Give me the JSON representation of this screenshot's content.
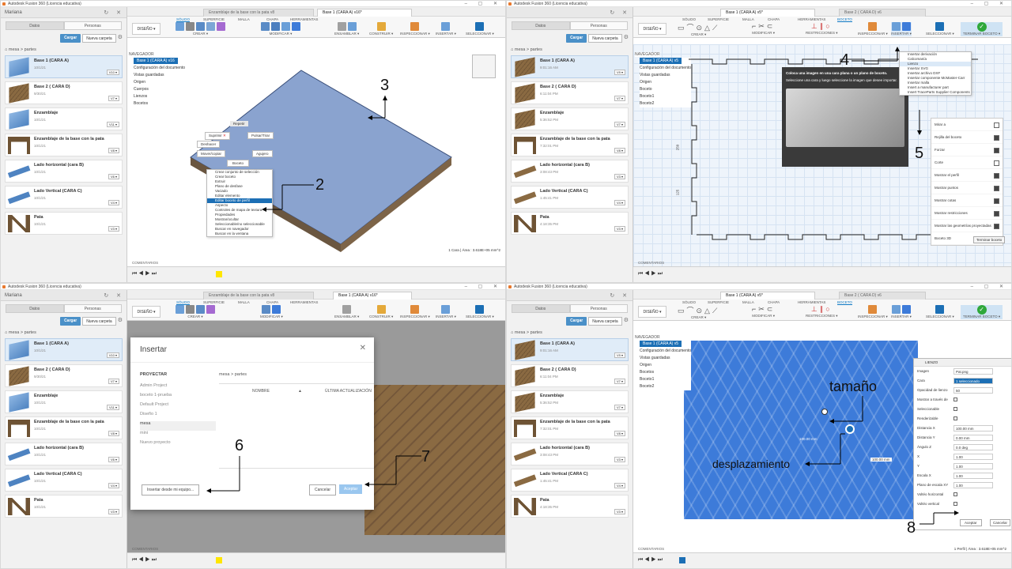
{
  "app": {
    "title": "Autodesk Fusion 360 (Licencia educativa)",
    "user": "Mariana",
    "win_controls": "– ▢ ✕"
  },
  "data_panel": {
    "tabs": [
      "Datos",
      "Personas"
    ],
    "load_button": "Cargar",
    "new_folder_button": "Nueva carpeta",
    "breadcrumb": "mesa  >  partes",
    "files_q1": [
      {
        "name": "Base 1 (CARA A)",
        "date": "10/1/21",
        "ver": "V10 ▾",
        "thumb": "blue"
      },
      {
        "name": "Base 2 ( CARA D)",
        "date": "9/30/21",
        "ver": "V7 ▾",
        "thumb": "wood"
      },
      {
        "name": "Enzamblaje",
        "date": "10/1/21",
        "ver": "V11 ▾",
        "thumb": "blue"
      },
      {
        "name": "Enzamblaje de la base con la pata",
        "date": "10/1/21",
        "ver": "V8 ▾",
        "thumb": "table"
      },
      {
        "name": "Lado horizontal (cara B)",
        "date": "10/1/21",
        "ver": "V6 ▾",
        "thumb": "stickb"
      },
      {
        "name": "Lado Vertical (CARA C)",
        "date": "10/1/21",
        "ver": "V4 ▾",
        "thumb": "stickb"
      },
      {
        "name": "Pata",
        "date": "10/1/21",
        "ver": "V3 ▾",
        "thumb": "leg"
      }
    ],
    "files_q2": [
      {
        "name": "Base 1 (CARA A)",
        "date": "9:01:16 AM",
        "ver": "V9 ▾",
        "thumb": "wood"
      },
      {
        "name": "Base 2 ( CARA D)",
        "date": "6:11:04 PM",
        "ver": "V7 ▾",
        "thumb": "wood"
      },
      {
        "name": "Enzamblaje",
        "date": "5:36:52 PM",
        "ver": "V7 ▾",
        "thumb": "wood"
      },
      {
        "name": "Enzamblaje de la base con la pata",
        "date": "7:32:01 PM",
        "ver": "V8 ▾",
        "thumb": "table"
      },
      {
        "name": "Lado horizontal (cara B)",
        "date": "3:08:43 PM",
        "ver": "V3 ▾",
        "thumb": "stick"
      },
      {
        "name": "Lado Vertical (CARA C)",
        "date": "1:45:41 PM",
        "ver": "V4 ▾",
        "thumb": "stick"
      },
      {
        "name": "Pata",
        "date": "4:18:35 PM",
        "ver": "V3 ▾",
        "thumb": "leg"
      }
    ]
  },
  "doc_tabs": {
    "assembly": "Enzamblaje de la base  con la pata v8",
    "base1_q1": "Base 1 (CARA A) v16*",
    "base1_q2": "Base 1 (CARA A) v5*",
    "base2": "Base 2 ( CARA D) v6"
  },
  "ribbon": {
    "tabs_model": [
      "SÓLIDO",
      "SUPERFICIE",
      "MALLA",
      "CHAPA",
      "HERRAMIENTAS"
    ],
    "tabs_sketch": [
      "SÓLIDO",
      "SUPERFICIE",
      "MALLA",
      "CHAPA",
      "HERRAMIENTAS",
      "BOCETO"
    ],
    "design": "DISEÑO ▾",
    "groups_model": [
      "CREAR ▾",
      "MODIFICAR ▾",
      "ENSAMBLAR ▾",
      "CONSTRUIR ▾",
      "INSPECCIONAR ▾",
      "INSERTAR ▾",
      "SELECCIONAR ▾"
    ],
    "groups_sketch": [
      "CREAR ▾",
      "MODIFICAR ▾",
      "RESTRICCIONES ▾",
      "INSPECCIONAR ▾",
      "INSERTAR ▾",
      "SELECCIONAR ▾",
      "TERMINAR BOCETO ▾"
    ]
  },
  "browser": {
    "navigator": "NAVEGADOR",
    "root_q1": "Base 1 (CARA A) v16",
    "root_q2": "Base 1 (CARA A) v5",
    "nodes_q1": [
      "Configuración del documento",
      "Vistas guardadas",
      "Origen",
      "Cuerpos",
      "Lienzos",
      "Bocetos"
    ],
    "nodes_q2": [
      "Configuración del documento",
      "Vistas guardadas",
      "Origen",
      "Boceto",
      "Boceto1",
      "Boceto2"
    ],
    "nodes_q4": [
      "Configuración del documento",
      "Vistas guardadas",
      "Origen",
      "Bocetos",
      "Boceto1",
      "Boceto2"
    ]
  },
  "marking_menu": {
    "repeat": "Repetir",
    "delete": "Suprimir",
    "undo": "Deshacer",
    "press_pull": "Pulsar/Tirar",
    "move_copy": "Mover/copiar",
    "sketch": "Boceto",
    "hole": "Agujero"
  },
  "context_menu": [
    "Crear conjunto de selección",
    "Crear boceto",
    "Extruir",
    "Plano de desfase",
    "Vaciado",
    "Editar elemento",
    "Editar boceto de perfil",
    "Aspecto",
    "Controles de mapa de textura",
    "Propiedades",
    "Mostrar/ocultar",
    "Seleccionable/no seleccionable",
    "Buscar en navegador",
    "Buscar en la ventana"
  ],
  "insert_menu": [
    "Insertar derivación",
    "Calcomanía",
    "Lienzo",
    "Insertar SVG",
    "Insertar archivo DXF",
    "Insertar componente McMaster-Carr",
    "Insertar malla",
    "Insert a manufacturer part",
    "Insert TraceParts Supplier Components"
  ],
  "tooltip": {
    "title": "Coloca una imagen en una cara plana o un plano de boceto.",
    "body": "Seleccione una cara y luego seleccione la imagen que desee importar."
  },
  "sketch_palette": [
    {
      "label": "Mirar a",
      "on": false
    },
    {
      "label": "Rejilla del boceto",
      "on": true
    },
    {
      "label": "Forzar",
      "on": true
    },
    {
      "label": "Corte",
      "on": false
    },
    {
      "label": "Mostrar el perfil",
      "on": true
    },
    {
      "label": "Mostrar puntos",
      "on": true
    },
    {
      "label": "Mostrar cotas",
      "on": true
    },
    {
      "label": "Mostrar restricciones",
      "on": true
    },
    {
      "label": "Mostrar las geometrías proyectadas",
      "on": true
    },
    {
      "label": "Boceto 3D",
      "on": false
    }
  ],
  "finish_sketch": "Terminar boceto",
  "insert_dialog": {
    "title": "Insertar",
    "project_header": "PROYECTAR",
    "projects": [
      "Admin Project",
      "boceto 1-prueba",
      "Default Project",
      "Diseño 1",
      "mesa",
      "mini",
      "Nuevo proyecto"
    ],
    "path": "mesa  >  partes",
    "col_name": "NOMBRE",
    "col_updated": "ÚLTIMA ACTUALIZACIÓN",
    "from_computer": "Insertar desde mi equipo...",
    "cancel": "Cancelar",
    "accept": "Aceptar"
  },
  "canvas_panel": {
    "title": "LIENZO",
    "rows": [
      {
        "label": "Imagen",
        "value": "Pat.png"
      },
      {
        "label": "Cara",
        "value": "1 seleccionado"
      },
      {
        "label": "Opacidad de lienzo",
        "value": "50"
      },
      {
        "label": "Mostrar a través de",
        "value": ""
      },
      {
        "label": "Seleccionable",
        "value": ""
      },
      {
        "label": "Renderizable",
        "value": ""
      },
      {
        "label": "Distancia X",
        "value": "100.00 mm"
      },
      {
        "label": "Distancia Y",
        "value": "0.00 mm"
      },
      {
        "label": "Ángulo Z",
        "value": "0.0 deg"
      },
      {
        "label": "X",
        "value": "1.00"
      },
      {
        "label": "Y",
        "value": "1.00"
      },
      {
        "label": "Escala X",
        "value": "1.00"
      },
      {
        "label": "Plano de escala XY",
        "value": "1.00"
      },
      {
        "label": "Voltéo horizontal",
        "value": ""
      },
      {
        "label": "Voltéo vertical",
        "value": ""
      }
    ],
    "accept": "Aceptar",
    "cancel": "Cancelar"
  },
  "status": {
    "q1": "1 Cara | Área : 3.618E+05 mm^2",
    "q4": "1 Perfil | Área : 3.618E+05 mm^2",
    "comments": "COMENTARIOS",
    "dim_100": "100.00 mm",
    "dim_0": "0.0 deg",
    "ruler_1": "250",
    "ruler_2": "125"
  },
  "annotations": {
    "n2": "2",
    "n3": "3",
    "n4": "4",
    "n5": "5",
    "n6": "6",
    "n7": "7",
    "n8": "8",
    "size": "tamaño",
    "offset": "desplazamiento"
  },
  "colors": {
    "accent": "#1c6fb5",
    "plate": "#8aa3cf",
    "wood": "#8a6a42",
    "grid_blue": "#3d7bd9"
  }
}
